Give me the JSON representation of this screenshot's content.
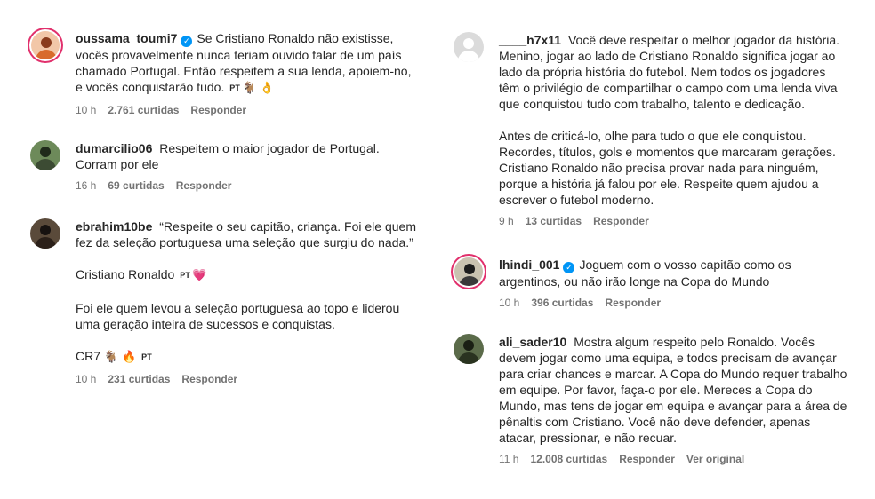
{
  "left": [
    {
      "username": "oussama_toumi7",
      "verified": true,
      "paragraphs": [
        "Se Cristiano Ronaldo não existisse, vocês provavelmente nunca teriam ouvido falar de um país chamado Portugal. Então respeitem a sua lenda, apoiem-no, e vocês conquistarão tudo."
      ],
      "tail": [
        "PT",
        "🐐",
        "👌"
      ],
      "time": "10 h",
      "likes": "2.761 curtidas",
      "reply": "Responder",
      "avatar_colors": [
        "#f2c7a8",
        "#d86b2c",
        "#8a3b1c"
      ]
    },
    {
      "username": "dumarcilio06",
      "verified": false,
      "paragraphs": [
        "Respeitem o maior jogador de Portugal. Corram por ele"
      ],
      "tail": [],
      "time": "16 h",
      "likes": "69 curtidas",
      "reply": "Responder",
      "avatar_colors": [
        "#6d8a5a",
        "#3c4b33",
        "#1f2a1a"
      ]
    },
    {
      "username": "ebrahim10be",
      "verified": false,
      "paragraphs": [
        "“Respeite o seu capitão, criança. Foi ele quem fez da seleção portuguesa uma seleção que surgiu do nada.”",
        "Cristiano Ronaldo",
        "Foi ele quem levou a seleção portuguesa ao topo e liderou uma geração inteira de sucessos e conquistas.",
        "CR7"
      ],
      "p2_tail": [
        "PT",
        "💗"
      ],
      "p4_tail": [
        "🐐",
        "🔥",
        "PT"
      ],
      "time": "10 h",
      "likes": "231 curtidas",
      "reply": "Responder",
      "avatar_colors": [
        "#5a4a3a",
        "#2b2019",
        "#171210"
      ]
    }
  ],
  "right": [
    {
      "username": "____h7x11",
      "verified": false,
      "paragraphs": [
        "Você deve respeitar o melhor jogador da história. Menino, jogar ao lado de Cristiano Ronaldo significa jogar ao lado da própria história do futebol. Nem todos os jogadores têm o privilégio de compartilhar o campo com uma lenda viva que conquistou tudo com trabalho, talento e dedicação.",
        "Antes de criticá-lo, olhe para tudo o que ele conquistou. Recordes, títulos, gols e momentos que marcaram gerações. Cristiano Ronaldo não precisa provar nada para ninguém, porque a história já falou por ele. Respeite quem ajudou a escrever o futebol moderno."
      ],
      "time": "9 h",
      "likes": "13 curtidas",
      "reply": "Responder",
      "avatar_colors": [
        "#dbdbdb",
        "#ffffff",
        "#ffffff"
      ]
    },
    {
      "username": "lhindi_001",
      "verified": true,
      "paragraphs": [
        "Joguem com o vosso capitão como os argentinos, ou não irão longe na Copa do Mundo"
      ],
      "time": "10 h",
      "likes": "396 curtidas",
      "reply": "Responder",
      "avatar_colors": [
        "#c9c2b0",
        "#3a3a3a",
        "#1c1c1c"
      ]
    },
    {
      "username": "ali_sader10",
      "verified": false,
      "paragraphs": [
        "Mostra algum respeito pelo Ronaldo. Vocês devem jogar como uma equipa, e todos precisam de avançar para criar chances e marcar. A Copa do Mundo requer trabalho em equipe. Por favor, faça-o por ele. Mereces a Copa do Mundo, mas tens de jogar em equipa e avançar para a área de pênaltis com Cristiano. Você não deve defender, apenas atacar, pressionar, e não recuar."
      ],
      "time": "11 h",
      "likes": "12.008 curtidas",
      "reply": "Responder",
      "see_original": "Ver original",
      "avatar_colors": [
        "#5b6b4a",
        "#2a3320",
        "#1a1f14"
      ]
    }
  ]
}
